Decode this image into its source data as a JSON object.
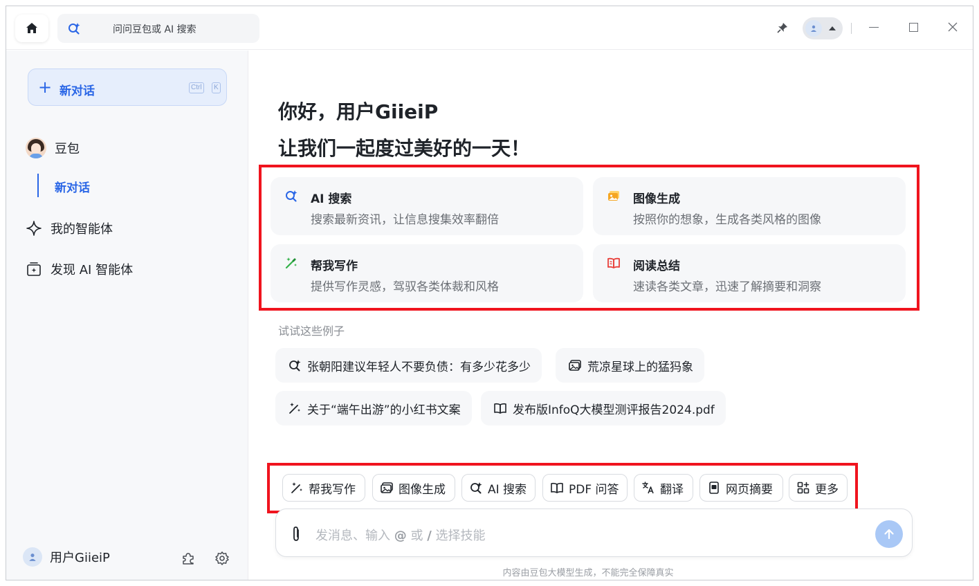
{
  "titlebar": {
    "search_placeholder": "问问豆包或 AI 搜索"
  },
  "sidebar": {
    "new_chat_label": "新对话",
    "shortcut_ctrl": "Ctrl",
    "shortcut_key": "K",
    "items": [
      {
        "label": "豆包"
      },
      {
        "label": "新对话"
      },
      {
        "label": "我的智能体"
      },
      {
        "label": "发现 AI 智能体"
      }
    ],
    "user_name": "用户GiieiP"
  },
  "main": {
    "greeting_line1": "你好，用户GiieiP",
    "greeting_line2": "让我们一起度过美好的一天！",
    "cards": [
      {
        "title": "AI 搜索",
        "desc": "搜索最新资讯，让信息搜集效率翻倍",
        "icon": "ai-search-icon",
        "color": "#2a66e6"
      },
      {
        "title": "图像生成",
        "desc": "按照你的想象，生成各类风格的图像",
        "icon": "image-icon",
        "color": "#f5a623"
      },
      {
        "title": "帮我写作",
        "desc": "提供写作灵感，驾驭各类体裁和风格",
        "icon": "magic-pen-icon",
        "color": "#34b24a"
      },
      {
        "title": "阅读总结",
        "desc": "速读各类文章，迅速了解摘要和洞察",
        "icon": "book-icon",
        "color": "#e8403b"
      }
    ],
    "examples_label": "试试这些例子",
    "examples": [
      {
        "text": "张朝阳建议年轻人不要负债：有多少花多少",
        "icon": "ai-search-icon"
      },
      {
        "text": "荒凉星球上的猛犸象",
        "icon": "image-icon"
      },
      {
        "text": "关于“端午出游”的小红书文案",
        "icon": "magic-pen-icon"
      },
      {
        "text": "发布版InfoQ大模型测评报告2024.pdf",
        "icon": "book-icon"
      }
    ],
    "skills": [
      {
        "label": "帮我写作",
        "icon": "magic-pen-icon"
      },
      {
        "label": "图像生成",
        "icon": "image-icon"
      },
      {
        "label": "AI 搜索",
        "icon": "ai-search-icon"
      },
      {
        "label": "PDF 问答",
        "icon": "book-icon"
      },
      {
        "label": "翻译",
        "icon": "translate-icon"
      },
      {
        "label": "网页摘要",
        "icon": "webpage-icon"
      },
      {
        "label": "更多",
        "icon": "grid-plus-icon"
      }
    ],
    "composer_placeholder_a": "发消息、输入 ",
    "composer_placeholder_at": "@",
    "composer_placeholder_b": " 或 ",
    "composer_placeholder_slash": "/",
    "composer_placeholder_c": " 选择技能",
    "disclaimer": "内容由豆包大模型生成，不能完全保障真实"
  }
}
